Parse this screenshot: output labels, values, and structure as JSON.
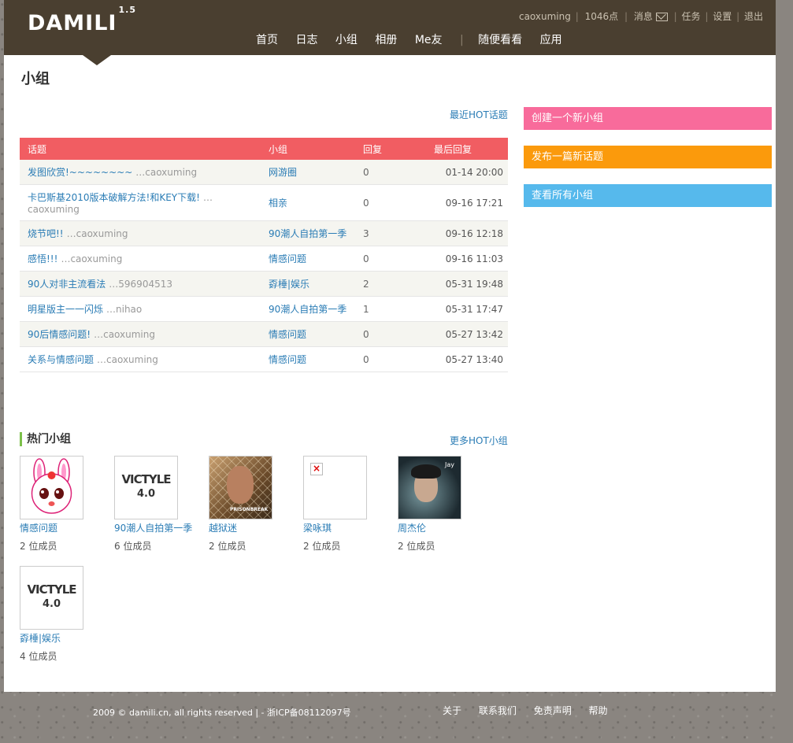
{
  "header": {
    "logo": "DAMILI",
    "logo_version": "1.5",
    "user": {
      "name": "caoxuming",
      "points": "1046点",
      "messages": "消息",
      "tasks": "任务",
      "settings": "设置",
      "logout": "退出"
    },
    "nav": [
      "首页",
      "日志",
      "小组",
      "相册",
      "Me友",
      "随便看看",
      "应用"
    ]
  },
  "main": {
    "title": "小组",
    "recent_hot_link": "最近HOT话题",
    "table": {
      "headers": [
        "话题",
        "小组",
        "回复",
        "最后回复"
      ],
      "rows": [
        {
          "topic": "发图欣赏!~~~~~~~~",
          "author": "…caoxuming",
          "group": "网游圈",
          "replies": "0",
          "last": "01-14 20:00"
        },
        {
          "topic": "卡巴斯基2010版本破解方法!和KEY下载!",
          "author": "…caoxuming",
          "group": "相亲",
          "replies": "0",
          "last": "09-16 17:21"
        },
        {
          "topic": "烧节吧!!",
          "author": "…caoxuming",
          "group": "90潮人自拍第一季",
          "replies": "3",
          "last": "09-16 12:18"
        },
        {
          "topic": "感悟!!!",
          "author": "…caoxuming",
          "group": "情感问题",
          "replies": "0",
          "last": "09-16 11:03"
        },
        {
          "topic": "90人对非主流看法",
          "author": "…596904513",
          "group": "孬棰|娱乐",
          "replies": "2",
          "last": "05-31 19:48"
        },
        {
          "topic": "明星版主一一闪烁",
          "author": "…nihao",
          "group": "90潮人自拍第一季",
          "replies": "1",
          "last": "05-31 17:47"
        },
        {
          "topic": "90后情感问题!",
          "author": "…caoxuming",
          "group": "情感问题",
          "replies": "0",
          "last": "05-27 13:42"
        },
        {
          "topic": "关系与情感问题",
          "author": "…caoxuming",
          "group": "情感问题",
          "replies": "0",
          "last": "05-27 13:40"
        }
      ]
    },
    "hot_groups": {
      "title": "热门小组",
      "more_link": "更多HOT小组",
      "groups": [
        {
          "name": "情感问题",
          "members": "2 位成员",
          "image": "bunny"
        },
        {
          "name": "90潮人自拍第一季",
          "members": "6 位成员",
          "image": "victyle"
        },
        {
          "name": "越狱迷",
          "members": "2 位成员",
          "image": "prisonbreak"
        },
        {
          "name": "梁咏琪",
          "members": "2 位成员",
          "image": "broken"
        },
        {
          "name": "周杰伦",
          "members": "2 位成员",
          "image": "jay"
        },
        {
          "name": "孬棰|娱乐",
          "members": "4 位成员",
          "image": "victyle"
        }
      ]
    },
    "victyle_text": "VICTYLE",
    "victyle_sub": "4.0",
    "pb_text": "PRISONBREAK",
    "jay_text": "Jay"
  },
  "sidebar": {
    "buttons": [
      {
        "label": "创建一个新小组",
        "color": "#f86b9b"
      },
      {
        "label": "发布一篇新话题",
        "color": "#fb9a0c"
      },
      {
        "label": "查看所有小组",
        "color": "#56b9ec"
      }
    ]
  },
  "footer": {
    "copyright": "2009 © damili.cn, all rights reserved | - 浙ICP备08112097号",
    "links": [
      "关于",
      "联系我们",
      "免责声明",
      "帮助"
    ]
  }
}
